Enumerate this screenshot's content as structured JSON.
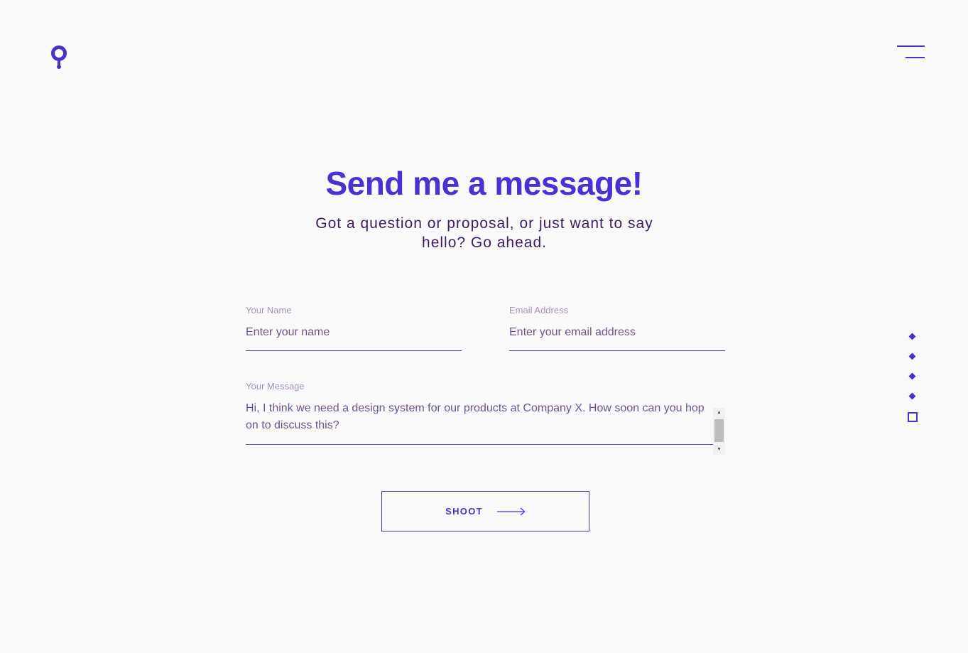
{
  "header": {
    "logo_icon": "location-pin-icon",
    "menu_icon": "hamburger-menu-icon"
  },
  "contact": {
    "title": "Send me a message!",
    "subtitle": "Got a question or proposal, or just want to say hello? Go ahead."
  },
  "form": {
    "name": {
      "label": "Your Name",
      "placeholder": "Enter your name",
      "value": ""
    },
    "email": {
      "label": "Email Address",
      "placeholder": "Enter your email address",
      "value": ""
    },
    "message": {
      "label": "Your Message",
      "placeholder": "",
      "value": "Hi, I think we need a design system for our products at Company X. How soon can you hop on to discuss this?"
    },
    "submit_label": "SHOOT",
    "submit_icon": "arrow-right-icon"
  },
  "section_nav": {
    "items": [
      {
        "icon": "diamond-icon",
        "active": false
      },
      {
        "icon": "diamond-icon",
        "active": false
      },
      {
        "icon": "diamond-icon",
        "active": false
      },
      {
        "icon": "diamond-icon",
        "active": false
      },
      {
        "icon": "square-outline-icon",
        "active": true
      }
    ]
  },
  "colors": {
    "background": "#f9f9fa",
    "accent": "#4b30c7",
    "heading": "#4b30d2",
    "subtitle": "#3d1d5e",
    "label": "#a892b5",
    "input_text": "#6e5589"
  }
}
